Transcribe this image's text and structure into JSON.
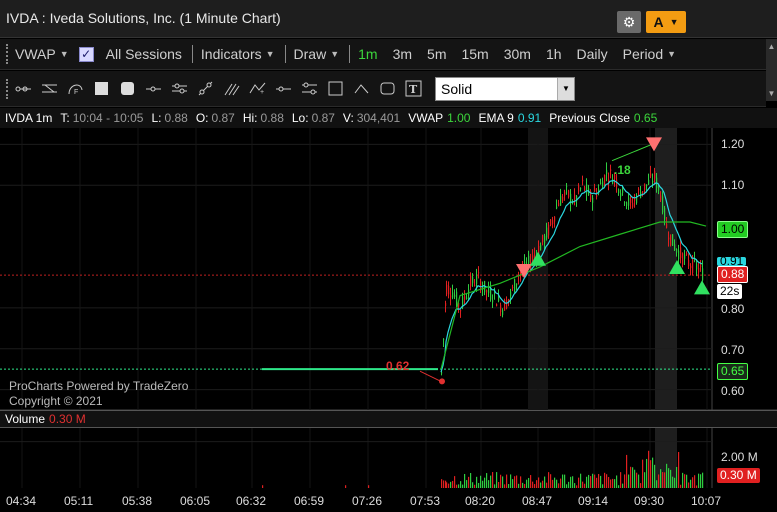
{
  "window": {
    "title": "IVDA : Iveda Solutions, Inc. (1 Minute Chart)",
    "account_label": "A"
  },
  "toolbar": {
    "vwap_label": "VWAP",
    "all_sessions_label": "All Sessions",
    "indicators_label": "Indicators",
    "draw_label": "Draw",
    "timeframes": [
      "1m",
      "3m",
      "5m",
      "15m",
      "30m",
      "1h",
      "Daily"
    ],
    "active_timeframe": "1m",
    "period_label": "Period"
  },
  "drawing_tools": {
    "line_style_value": "Solid",
    "icons": [
      "ray-icon",
      "parallel-channel-icon",
      "fibonacci-icon",
      "filled-square-icon",
      "rounded-square-icon",
      "horizontal-line-icon",
      "channel-icon",
      "trend-line-icon",
      "pitchfork-icon",
      "polyline-icon",
      "plus-line-icon",
      "horizontal-ray-icon",
      "regression-icon",
      "rectangle-icon",
      "arc-icon",
      "rounded-rect-icon",
      "text-tool-icon"
    ]
  },
  "info_bar": {
    "symbol": "IVDA 1m",
    "t_label": "T:",
    "t_value": "10:04 - 10:05",
    "l_label": "L:",
    "l_value": "0.88",
    "o_label": "O:",
    "o_value": "0.87",
    "hi_label": "Hi:",
    "hi_value": "0.88",
    "lo_label": "Lo:",
    "lo_value": "0.87",
    "v_label": "V:",
    "v_value": "304,401",
    "vwap_label": "VWAP",
    "vwap_value": "1.00",
    "ema_label": "EMA 9",
    "ema_value": "0.91",
    "prev_close_label": "Previous Close",
    "prev_close_value": "0.65"
  },
  "watermark": {
    "line1": "ProCharts Powered by TradeZero",
    "line2": "Copyright © 2021"
  },
  "volume_panel": {
    "label": "Volume",
    "value": "0.30 M",
    "axis_label": "2.00 M",
    "tag_value": "0.30 M"
  },
  "price_tags": {
    "vwap": "1.00",
    "ema": "0.91",
    "last": "0.88",
    "countdown": "22s",
    "prev_close": "0.65"
  },
  "annotations": {
    "low_label": "0.62",
    "high_label": ".18"
  },
  "colors": {
    "up": "#2ecc40",
    "down": "#e02020",
    "vwap": "#22b822",
    "ema": "#2ad7e0",
    "prev_close": "#2ee88a",
    "accent": "#f39c12"
  },
  "chart_data": {
    "type": "candlestick",
    "y_ticks": [
      "1.20",
      "1.10",
      "0.80",
      "0.70",
      "0.60"
    ],
    "y_tick_values": [
      1.2,
      1.1,
      0.8,
      0.7,
      0.6
    ],
    "ylim": [
      0.55,
      1.24
    ],
    "x_ticks": [
      "04:34",
      "05:11",
      "05:38",
      "06:05",
      "06:32",
      "06:59",
      "07:26",
      "07:53",
      "08:20",
      "08:47",
      "09:14",
      "09:30",
      "10:07"
    ],
    "previous_close": 0.65,
    "last_price": 0.88,
    "vwap": 1.0,
    "ema9": 0.91,
    "low_marker": 0.62,
    "volume_ylim": [
      0,
      2.5
    ],
    "volume_tick": 2.0
  }
}
